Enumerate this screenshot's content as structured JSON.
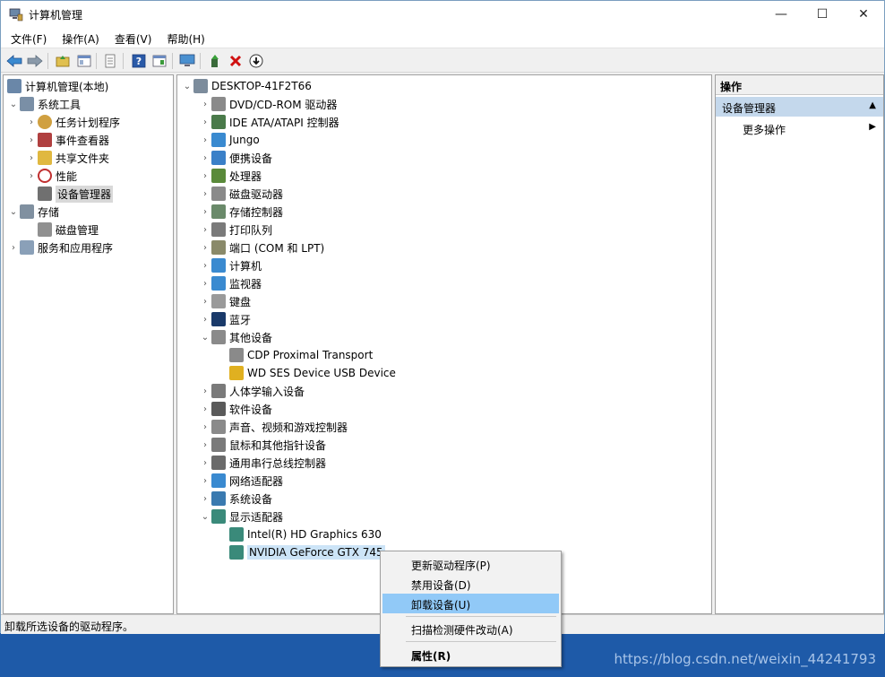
{
  "window": {
    "title": "计算机管理",
    "controls": {
      "minimize": "—",
      "maximize": "☐",
      "close": "✕"
    }
  },
  "menubar": [
    "文件(F)",
    "操作(A)",
    "查看(V)",
    "帮助(H)"
  ],
  "left_tree": [
    {
      "label": "计算机管理(本地)",
      "icon": "computer-management-icon",
      "color": "#6a87a8"
    },
    {
      "label": "系统工具",
      "icon": "tools-icon",
      "color": "#7a8fa6"
    },
    {
      "label": "任务计划程序",
      "icon": "clock-icon",
      "color": "#d0a040"
    },
    {
      "label": "事件查看器",
      "icon": "event-viewer-icon",
      "color": "#b04040"
    },
    {
      "label": "共享文件夹",
      "icon": "shared-folder-icon",
      "color": "#e0b840"
    },
    {
      "label": "性能",
      "icon": "performance-icon",
      "color": "#c03030"
    },
    {
      "label": "设备管理器",
      "icon": "device-manager-icon",
      "color": "#707070"
    },
    {
      "label": "存储",
      "icon": "storage-icon",
      "color": "#8090a0"
    },
    {
      "label": "磁盘管理",
      "icon": "disk-management-icon",
      "color": "#909090"
    },
    {
      "label": "服务和应用程序",
      "icon": "services-icon",
      "color": "#8aa0b8"
    }
  ],
  "device_tree": [
    {
      "label": "DESKTOP-41F2T66",
      "icon": "computer-icon",
      "color": "#7c8c9c"
    },
    {
      "label": "DVD/CD-ROM 驱动器",
      "icon": "dvd-drive-icon",
      "color": "#8a8a8a"
    },
    {
      "label": "IDE ATA/ATAPI 控制器",
      "icon": "ide-controller-icon",
      "color": "#4a7a4a"
    },
    {
      "label": "Jungo",
      "icon": "jungo-icon",
      "color": "#3a8ad0"
    },
    {
      "label": "便携设备",
      "icon": "portable-device-icon",
      "color": "#3a80c8"
    },
    {
      "label": "处理器",
      "icon": "processor-icon",
      "color": "#5a8a3a"
    },
    {
      "label": "磁盘驱动器",
      "icon": "disk-drive-icon",
      "color": "#8a8a8a"
    },
    {
      "label": "存储控制器",
      "icon": "storage-controller-icon",
      "color": "#6a8a6a"
    },
    {
      "label": "打印队列",
      "icon": "printer-icon",
      "color": "#7a7a7a"
    },
    {
      "label": "端口 (COM 和 LPT)",
      "icon": "port-icon",
      "color": "#8a8a6a"
    },
    {
      "label": "计算机",
      "icon": "computer-icon",
      "color": "#3a8ad0"
    },
    {
      "label": "监视器",
      "icon": "monitor-icon",
      "color": "#3a8ad0"
    },
    {
      "label": "键盘",
      "icon": "keyboard-icon",
      "color": "#9a9a9a"
    },
    {
      "label": "蓝牙",
      "icon": "bluetooth-icon",
      "color": "#1a3a6a"
    },
    {
      "label": "其他设备",
      "icon": "unknown-device-icon",
      "color": "#8a8a8a"
    },
    {
      "label": "CDP Proximal Transport",
      "icon": "unknown-device-icon",
      "color": "#8a8a8a"
    },
    {
      "label": "WD SES Device USB Device",
      "icon": "warning-device-icon",
      "color": "#e0b020"
    },
    {
      "label": "人体学输入设备",
      "icon": "hid-icon",
      "color": "#7a7a7a"
    },
    {
      "label": "软件设备",
      "icon": "software-device-icon",
      "color": "#5a5a5a"
    },
    {
      "label": "声音、视频和游戏控制器",
      "icon": "speaker-icon",
      "color": "#8a8a8a"
    },
    {
      "label": "鼠标和其他指针设备",
      "icon": "mouse-icon",
      "color": "#7a7a7a"
    },
    {
      "label": "通用串行总线控制器",
      "icon": "usb-icon",
      "color": "#6a6a6a"
    },
    {
      "label": "网络适配器",
      "icon": "network-adapter-icon",
      "color": "#3a8ad0"
    },
    {
      "label": "系统设备",
      "icon": "system-device-icon",
      "color": "#3a7ab0"
    },
    {
      "label": "显示适配器",
      "icon": "display-adapter-icon",
      "color": "#3a8a7a"
    },
    {
      "label": "Intel(R) HD Graphics 630",
      "icon": "display-adapter-icon",
      "color": "#3a8a7a"
    },
    {
      "label": "NVIDIA GeForce GTX 745",
      "icon": "display-adapter-icon",
      "color": "#3a8a7a"
    }
  ],
  "actions": {
    "header": "操作",
    "section": "设备管理器",
    "more": "更多操作"
  },
  "context_menu": [
    "更新驱动程序(P)",
    "禁用设备(D)",
    "卸载设备(U)",
    "扫描检测硬件改动(A)",
    "属性(R)"
  ],
  "status": "卸载所选设备的驱动程序。",
  "watermark": "https://blog.csdn.net/weixin_44241793",
  "colors": {
    "selection": "#cce4f7",
    "context_highlight": "#91c9f7",
    "taskbar": "#1e5aa8"
  }
}
